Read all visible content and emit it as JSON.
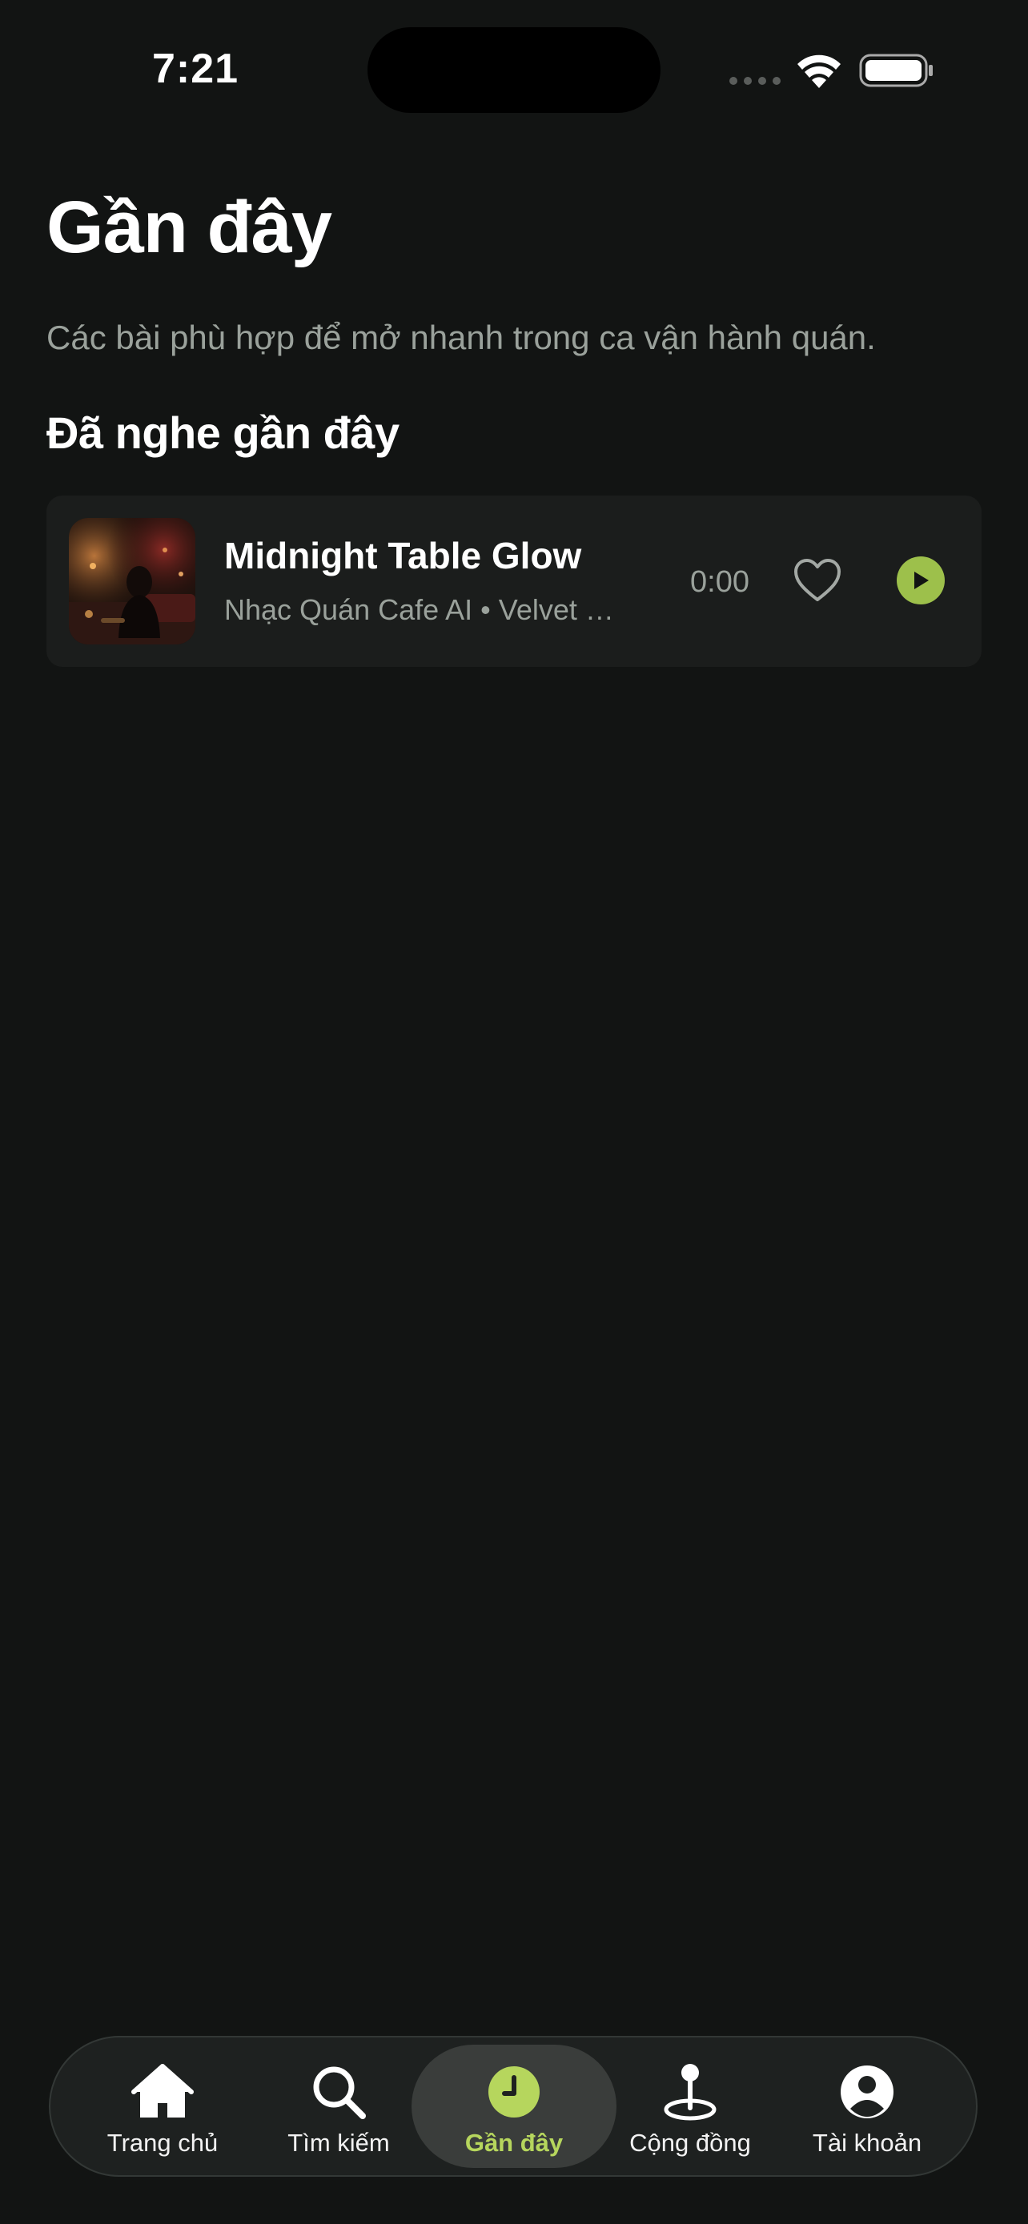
{
  "status_bar": {
    "time": "7:21"
  },
  "header": {
    "title": "Gần đây",
    "subtitle": "Các bài phù hợp để mở nhanh trong ca vận hành quán."
  },
  "recent": {
    "section_title": "Đã nghe gần đây",
    "tracks": [
      {
        "title": "Midnight Table Glow",
        "meta": "Nhạc Quán Cafe AI • Velvet Lounge",
        "duration": "0:00"
      }
    ]
  },
  "tab_bar": {
    "tabs": [
      {
        "label": "Trang chủ",
        "icon": "home-icon"
      },
      {
        "label": "Tìm kiếm",
        "icon": "search-icon"
      },
      {
        "label": "Gần đây",
        "icon": "clock-icon",
        "active": true
      },
      {
        "label": "Cộng đồng",
        "icon": "map-pin-icon"
      },
      {
        "label": "Tài khoản",
        "icon": "user-icon"
      }
    ]
  },
  "colors": {
    "background": "#121413",
    "card": "#1b1d1c",
    "accent": "#9dc04b",
    "accent_text": "#b6d65d",
    "muted_text": "#9aa19b"
  }
}
